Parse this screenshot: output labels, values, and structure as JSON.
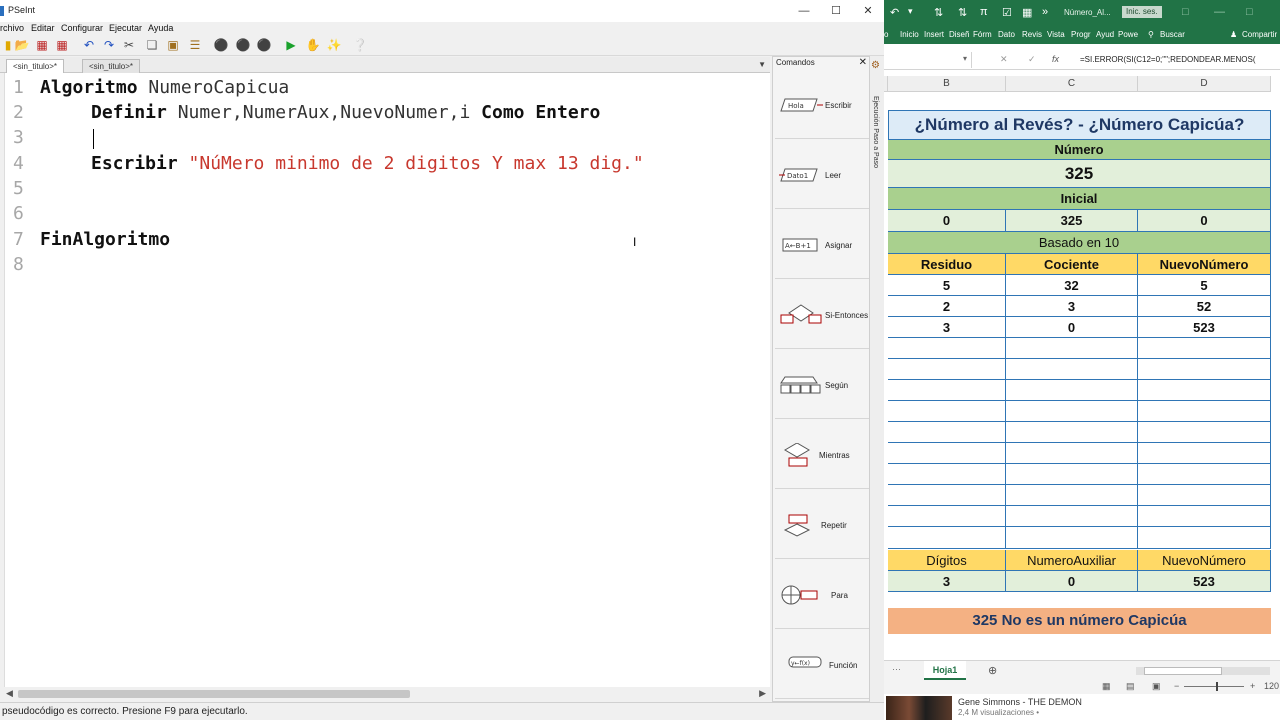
{
  "pseint": {
    "window_title": "PSeInt",
    "menu": [
      "rchivo",
      "Editar",
      "Configurar",
      "Ejecutar",
      "Ayuda"
    ],
    "tabs": [
      "<sin_titulo>*",
      "<sin_titulo>*"
    ],
    "code": {
      "line_numbers": [
        "1",
        "2",
        "3",
        "4",
        "5",
        "6",
        "7",
        "8"
      ],
      "l1_kw": "Algoritmo",
      "l1_name": " NumeroCapicua",
      "l2_kw": "Definir",
      "l2_vars": " Numer,NumerAux,NuevoNumer,i ",
      "l2_kw2": "Como Entero",
      "l4_kw": "Escribir",
      "l4_str": " \"NúMero minimo de 2 digitos Y max 13 dig.\"",
      "l7_kw": "FinAlgoritmo"
    },
    "status": "pseudocódigo es correcto. Presione F9 para ejecutarlo.",
    "commands_panel": {
      "title": "Comandos",
      "items": [
        "Escribir",
        "Leer",
        "Asignar",
        "Si-Entonces",
        "Según",
        "Mientras",
        "Repetir",
        "Para",
        "Función"
      ],
      "icon_texts": [
        "Hola",
        "Dato1",
        "A←B+1",
        "y←f(x)"
      ]
    },
    "side_strip": "Ejecución Paso a Paso"
  },
  "excel": {
    "title_doc": "Número_Al...",
    "signin": "Inic. ses.",
    "ribbon_tabs": [
      "o",
      "Inicio",
      "Insert",
      "Diseñ",
      "Fórm",
      "Dato",
      "Revis",
      "Vista",
      "Progr",
      "Ayud",
      "Powe",
      "Buscar",
      "Compartir"
    ],
    "formula": "=SI.ERROR(SI(C12=0;\"\";REDONDEAR.MENOS(",
    "columns": [
      "B",
      "C",
      "D"
    ],
    "title": "¿Número al Revés? - ¿Número Capicúa?",
    "numero_label": "Número",
    "numero_value": "325",
    "inicial_label": "Inicial",
    "inicial_values": [
      "0",
      "325",
      "0"
    ],
    "base_label": "Basado en  10",
    "headers": [
      "Residuo",
      "Cociente",
      "NuevoNúmero"
    ],
    "rows": [
      [
        "5",
        "32",
        "5"
      ],
      [
        "2",
        "3",
        "52"
      ],
      [
        "3",
        "0",
        "523"
      ]
    ],
    "bottom_headers": [
      "Dígitos",
      "NumeroAuxiliar",
      "NuevoNúmero"
    ],
    "bottom_values": [
      "3",
      "0",
      "523"
    ],
    "result": "325 No es un número Capicúa",
    "sheet_tab": "Hoja1",
    "zoom": "120"
  },
  "video": {
    "title": "Gene Simmons - THE DEMON",
    "views": "2,4 M visualizaciones •"
  }
}
